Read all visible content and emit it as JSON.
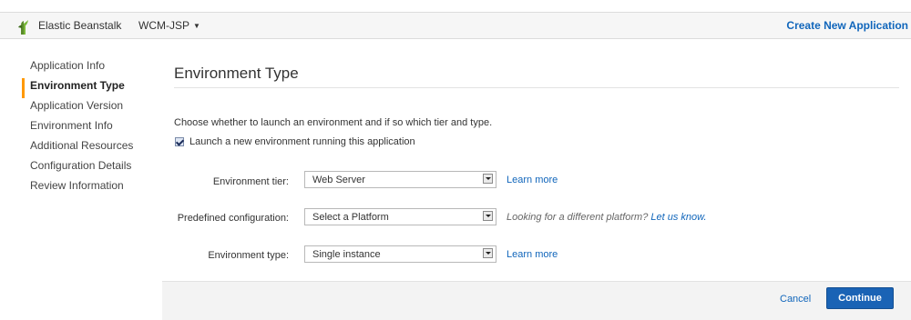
{
  "topbar": {
    "logo_icon": "elastic-beanstalk-logo",
    "service_name": "Elastic Beanstalk",
    "application_name": "WCM-JSP",
    "create_link": "Create New Application"
  },
  "sidebar": {
    "items": [
      {
        "label": "Application Info"
      },
      {
        "label": "Environment Type",
        "active": true
      },
      {
        "label": "Application Version"
      },
      {
        "label": "Environment Info"
      },
      {
        "label": "Additional Resources"
      },
      {
        "label": "Configuration Details"
      },
      {
        "label": "Review Information"
      }
    ]
  },
  "main": {
    "title": "Environment Type",
    "description": "Choose whether to launch an environment and if so which tier and type.",
    "launch_checkbox": {
      "label": "Launch a new environment running this application",
      "checked": true
    },
    "fields": {
      "tier": {
        "label": "Environment tier:",
        "value": "Web Server",
        "link": "Learn more"
      },
      "config": {
        "label": "Predefined configuration:",
        "value": "Select a Platform",
        "hint": "Looking for a different platform?",
        "hint_link": "Let us know."
      },
      "type": {
        "label": "Environment type:",
        "value": "Single instance",
        "link": "Learn more"
      }
    }
  },
  "footer": {
    "cancel": "Cancel",
    "continue": "Continue"
  },
  "colors": {
    "accent_link": "#1166bb",
    "active_marker": "#ff9900",
    "primary_button": "#1a63b5"
  }
}
